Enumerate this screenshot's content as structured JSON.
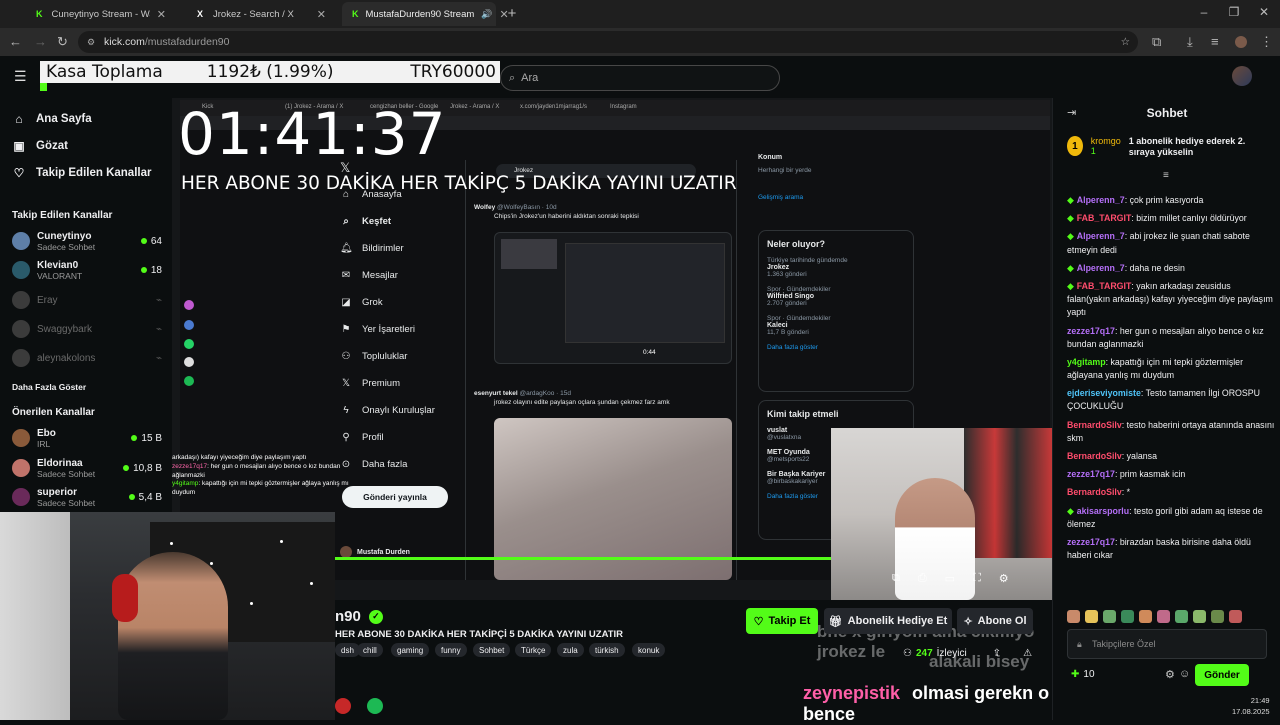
{
  "browser": {
    "tabs": [
      {
        "label": "Cuneytinyo Stream - Watch Live",
        "favicon": "K",
        "color": "#53fc18"
      },
      {
        "label": "Jrokez - Search / X",
        "favicon": "X",
        "color": "#ffffff"
      },
      {
        "label": "MustafaDurden90 Stream",
        "favicon": "K",
        "color": "#53fc18"
      }
    ],
    "url_host": "kick.com",
    "url_path": "/mustafadurden90"
  },
  "header": {
    "kasa_label": "Kasa Toplama",
    "kasa_amount": "1192₺ (1.99%)",
    "kasa_goal": "TRY60000",
    "search_placeholder": "Ara"
  },
  "sidebar": {
    "nav": [
      {
        "label": "Ana Sayfa",
        "icon": "home-icon"
      },
      {
        "label": "Gözat",
        "icon": "browse-icon"
      },
      {
        "label": "Takip Edilen Kanallar",
        "icon": "heart-icon"
      }
    ],
    "followed_title": "Takip Edilen Kanallar",
    "followed": [
      {
        "name": "Cuneytinyo",
        "sub": "Sadece Sohbet",
        "count": "64",
        "online": true,
        "color": "#5e7fa8"
      },
      {
        "name": "Klevian0",
        "sub": "VALORANT",
        "count": "18",
        "online": true,
        "color": "#2a5a6a"
      },
      {
        "name": "Eray",
        "sub": "",
        "count": "",
        "online": false
      },
      {
        "name": "Swaggybark",
        "sub": "",
        "count": "",
        "online": false
      },
      {
        "name": "aleynakolons",
        "sub": "",
        "count": "",
        "online": false
      }
    ],
    "show_more": "Daha Fazla Göster",
    "recommended_title": "Önerilen Kanallar",
    "recommended": [
      {
        "name": "Ebo",
        "sub": "IRL",
        "count": "15 B",
        "color": "#8a5a3a"
      },
      {
        "name": "Eldorinaa",
        "sub": "Sadece Sohbet",
        "count": "10,8 B",
        "color": "#c0736a"
      },
      {
        "name": "superior",
        "sub": "Sadece Sohbet",
        "count": "5,4 B",
        "color": "#6a2a5a"
      }
    ]
  },
  "video": {
    "timer": "01:41:37",
    "banner": "HER ABONE 30 DAKİKA HER TAKİPÇ 5 DAKİKA YAYINI UZATIR",
    "inner_tabs": [
      "Kick",
      "(1) Jrokez - Arama / X",
      "cengizhan beller - Google",
      "Jrokez - Arama / X",
      "x.com/jayden1mjarrag1/s",
      "Instagram"
    ],
    "tw_nav": [
      "Anasayfa",
      "Keşfet",
      "Bildirimler",
      "Mesajlar",
      "Grok",
      "Yer İşaretleri",
      "Topluluklar",
      "Premium",
      "Onaylı Kuruluşlar",
      "Profil",
      "Daha fazla"
    ],
    "post_btn": "Gönderi yayınla",
    "tw_search": "Jrokez",
    "tw_profile": "Mustafa Durden",
    "post1_user": "Wolfey",
    "post1_handle": "@WolfeyBasın · 10d",
    "post1_text": "Chips'in Jrokez'un haberini aldıktan sonraki tepkisi",
    "post1_time": "0:44",
    "post2_user": "esenyurt tekel",
    "post2_handle": "@ardagKoo · 15d",
    "post2_text": "jrokez olayını edite paylaşan oçlara şundan çekmez farz amk",
    "trend_title": "Neler oluyor?",
    "trends": [
      {
        "cat": "Türkiye tarihinde gündemde",
        "name": "Jrokez",
        "posts": "1.363 gönderi"
      },
      {
        "cat": "Spor · Gündemdekiler",
        "name": "Wilfried Singo",
        "posts": "2.707 gönderi"
      },
      {
        "cat": "Spor · Gündemdekiler",
        "name": "Kaleci",
        "posts": "11,7 B gönderi"
      }
    ],
    "trend_more": "Daha fazla göster",
    "follow_title": "Kimi takip etmeli",
    "follow": [
      {
        "name": "vuslat",
        "handle": "@vuslatxna"
      },
      {
        "name": "MET Oyunda",
        "handle": "@metsports22"
      },
      {
        "name": "Bir Başka Kariyer",
        "handle": "@birbaskakariyer"
      }
    ],
    "follow_more": "Daha fazla göster",
    "location_title": "Konum",
    "location_opt": "Herhangi bir yerde",
    "advanced": "Gelişmiş arama",
    "overlay_chat": [
      {
        "u": "",
        "m": "arkadaşı) kafayı yiyeceğim diye paylaşım yaptı"
      },
      {
        "u": "zezze17q17",
        "m": ": her gun o mesajları alıyo bence o kız bundan ağlanmazki"
      },
      {
        "u": "y4gitamp",
        "m": ": kapattığı için mi tepki göztermişler ağlaya yanlış mı duydum"
      }
    ]
  },
  "stream": {
    "name": "n90",
    "title": "HER ABONE 30 DAKİKA HER TAKİPÇİ 5 DAKİKA YAYINI UZATIR",
    "tags": [
      "dsh",
      "chill",
      "gaming",
      "funny",
      "Sohbet",
      "Türkçe",
      "zula",
      "türkish",
      "konuk"
    ],
    "follow_btn": "Takip Et",
    "gift_btn": "Abonelik Hediye Et",
    "sub_btn": "Abone Ol",
    "viewers_count": "247",
    "viewers_label": "İzleyici",
    "ghost_line1": "bne x giriyom ama cikmiyo jrokez le",
    "ghost_line2": "alakali bisey",
    "sub_user": "zeynepistik",
    "sub_msg": "olmasi gerekn o bence"
  },
  "chat": {
    "title": "Sohbet",
    "pinned_user": "kromgo",
    "pinned_count": "1",
    "pinned_msg": "1 abonelik hediye ederek 2. sıraya yükselin",
    "messages": [
      {
        "user": "Alperenn_7",
        "color": "#b46ff7",
        "msg": ": çok prim kasıyorda"
      },
      {
        "user": "FAB_TARGIT",
        "color": "#ff4d6d",
        "msg": ": bizim millet canlıyı öldürüyor"
      },
      {
        "user": "Alperenn_7",
        "color": "#b46ff7",
        "msg": ": abi jrokez ile şuan chati sabote etmeyin dedi"
      },
      {
        "user": "Alperenn_7",
        "color": "#b46ff7",
        "msg": ": daha ne desin"
      },
      {
        "user": "FAB_TARGIT",
        "color": "#ff4d6d",
        "msg": ": yakın arkadaşı zeusidus falan(yakın arkadaşı) kafayı yiyeceğim diye paylaşım yaptı"
      },
      {
        "user": "zezze17q17",
        "color": "#b46ff7",
        "msg": ": her gun o mesajları alıyo bence o kız bundan aglanmazki"
      },
      {
        "user": "y4gitamp",
        "color": "#53fc18",
        "msg": ": kapattığı için mi tepki göztermişler ağlayana yanlış mı duydum"
      },
      {
        "user": "ejderiseviyomiste",
        "color": "#4fc3f7",
        "msg": ": Testo tamamen İlgi OROSPU ÇOCUKLUĞU"
      },
      {
        "user": "BernardoSilv",
        "color": "#ff4d6d",
        "msg": ": testo haberini ortaya atanında anasını skm"
      },
      {
        "user": "BernardoSilv",
        "color": "#ff4d6d",
        "msg": ": yalansa"
      },
      {
        "user": "zezze17q17",
        "color": "#b46ff7",
        "msg": ": prim kasmak icin"
      },
      {
        "user": "BernardoSilv",
        "color": "#ff4d6d",
        "msg": ": *"
      },
      {
        "user": "akisarsporlu",
        "color": "#b46ff7",
        "msg": ": testo goril gibi adam aq istese de ölemez"
      },
      {
        "user": "zezze17q17",
        "color": "#b46ff7",
        "msg": ": birazdan baska birisine daha öldü haberi cıkar"
      }
    ],
    "input_placeholder": "Takipçilere Özel",
    "points": "10",
    "send_btn": "Gönder"
  },
  "system": {
    "time": "21:49",
    "date": "17.08.2025"
  }
}
